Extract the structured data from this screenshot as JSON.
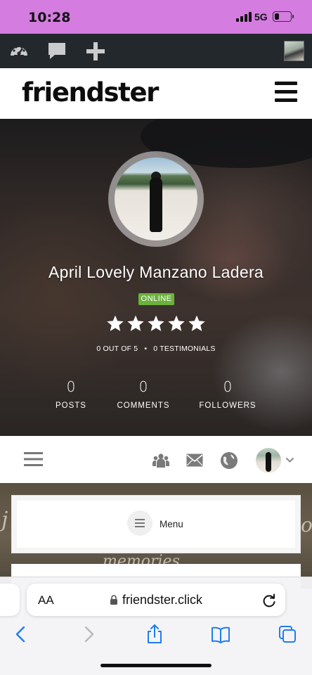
{
  "status_bar": {
    "time": "10:28",
    "network": "5G",
    "battery_level": 0.3
  },
  "admin_bar": {
    "icons": [
      "dashboard-icon",
      "comment-icon",
      "plus-icon"
    ]
  },
  "site": {
    "logo": "friendster"
  },
  "profile": {
    "name": "April Lovely Manzano Ladera",
    "status": "ONLINE",
    "rating_stars": 5,
    "rating_text": "0 OUT OF 5",
    "testimonials_text": "0 TESTIMONIALS",
    "stats": [
      {
        "value": "0",
        "label": "POSTS"
      },
      {
        "value": "0",
        "label": "COMMENTS"
      },
      {
        "value": "0",
        "label": "FOLLOWERS"
      }
    ]
  },
  "profile_nav": {
    "icons": [
      "menu-icon",
      "groups-icon",
      "mail-icon",
      "globe-icon",
      "chevron-down-icon"
    ]
  },
  "content": {
    "menu_label": "Menu",
    "cover_script_1": "j",
    "cover_script_2": "memories",
    "cover_script_3": "o"
  },
  "browser": {
    "aa_label": "AA",
    "url": "friendster.click",
    "toolbar_icons": [
      "back-icon",
      "forward-icon",
      "share-icon",
      "bookmarks-icon",
      "tabs-icon"
    ]
  },
  "colors": {
    "status_bar": "#d47ce0",
    "admin_bar": "#23282d",
    "online_badge": "#6bb23c",
    "safari_accent": "#1f7cf2"
  }
}
